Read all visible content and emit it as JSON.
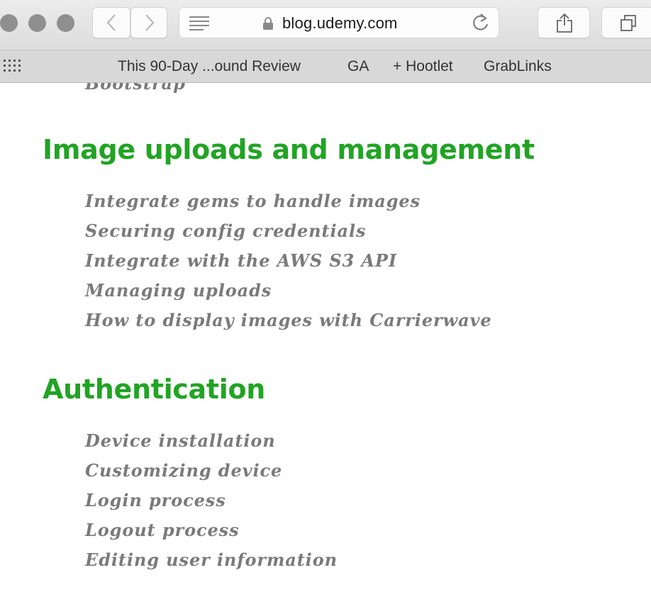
{
  "toolbar": {
    "url": "blog.udemy.com",
    "icons": [
      "lock-icon",
      "reader-icon",
      "reload-icon",
      "back-icon",
      "forward-icon",
      "share-icon",
      "tabs-icon",
      "grid-icon"
    ]
  },
  "bookmarks": {
    "items": [
      {
        "label": "This 90-Day ...ound Review"
      },
      {
        "label": "GA"
      },
      {
        "label": "+ Hootlet"
      },
      {
        "label": "GrabLinks"
      }
    ]
  },
  "content": {
    "partial_item": "Bootstrap",
    "sections": [
      {
        "heading": "Image uploads and management",
        "items": [
          "Integrate gems to handle images",
          "Securing config credentials",
          "Integrate with the AWS S3 API",
          "Managing uploads",
          "How to display images with Carrierwave"
        ]
      },
      {
        "heading": "Authentication",
        "items": [
          "Device installation",
          "Customizing device",
          "Login process",
          "Logout process",
          "Editing user information"
        ]
      }
    ]
  },
  "colors": {
    "heading": "#21a424",
    "item_text": "#7a7a7a",
    "toolbar_bg": "#e4e4e4",
    "bookmarks_bg": "#d8d8d8"
  }
}
